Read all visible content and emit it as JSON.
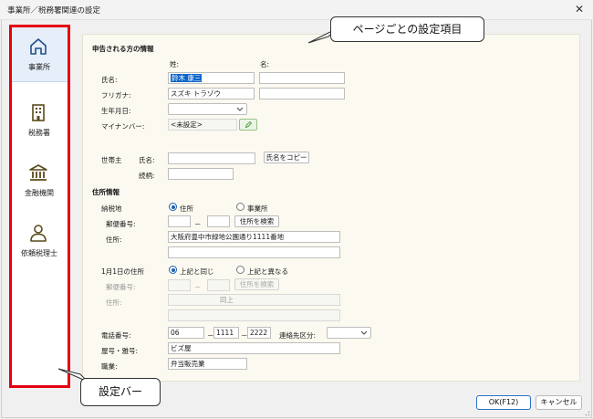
{
  "window": {
    "title": "事業所／税務署関連の設定",
    "close_glyph": "✕"
  },
  "sidebar": {
    "items": [
      {
        "label": "事業所",
        "icon": "home-icon",
        "active": true
      },
      {
        "label": "税務署",
        "icon": "building-icon",
        "active": false
      },
      {
        "label": "金融機関",
        "icon": "bank-icon",
        "active": false
      },
      {
        "label": "依頼税理士",
        "icon": "person-icon",
        "active": false
      }
    ]
  },
  "callouts": {
    "page_settings": "ページごとの設定項目",
    "settings_bar": "設定バー"
  },
  "form": {
    "declarant_section": "申告される方の情報",
    "col_last": "姓:",
    "col_first": "名:",
    "name_label": "氏名:",
    "name_last_value": "鈴木 康三",
    "name_first_value": "",
    "kana_label": "フリガナ:",
    "kana_last_value": "スズキ トラゾウ",
    "kana_first_value": "",
    "birth_label": "生年月日:",
    "birth_value": "",
    "mynumber_label": "マイナンバー:",
    "mynumber_value": "<未設定>",
    "householder_label": "世帯主",
    "hh_name_label": "氏名:",
    "hh_name_value": "",
    "copy_name_button": "氏名をコピー",
    "relation_label": "続柄:",
    "relation_value": "",
    "address_section": "住所情報",
    "tax_place_label": "納税地",
    "tax_place_option_home": "住所",
    "tax_place_option_office": "事業所",
    "postal_label": "郵便番号:",
    "postal_part1": "",
    "postal_dash": "－",
    "postal_part2": "",
    "search_address_button": "住所を検索",
    "address_label": "住所:",
    "address_value": "大阪府豊中市緑地公園通り1111番地",
    "address_line2": "",
    "jan1_label": "1月1日の住所",
    "jan1_option_same": "上記と同じ",
    "jan1_option_diff": "上記と異なる",
    "jan1_postal_label": "郵便番号:",
    "jan1_postal_dash": "－",
    "jan1_search_button": "住所を検索",
    "jan1_address_label": "住所:",
    "jan1_address_value": "同上",
    "phone_label": "電話番号:",
    "phone_1": "06",
    "phone_dash1": "－",
    "phone_2": "1111",
    "phone_dash2": "－",
    "phone_3": "2222",
    "contact_type_label": "連絡先区分:",
    "contact_type_value": "",
    "shop_name_label": "屋号・雅号:",
    "shop_name_value": "ビズ屋",
    "occupation_label": "職業:",
    "occupation_value": "弁当販売業"
  },
  "footer": {
    "ok_label": "OK(F12)",
    "cancel_label": "キャンセル"
  },
  "colors": {
    "accent_red": "#e50012",
    "accent_blue": "#1a5fb4",
    "panel_bg": "#fbf9f0"
  }
}
